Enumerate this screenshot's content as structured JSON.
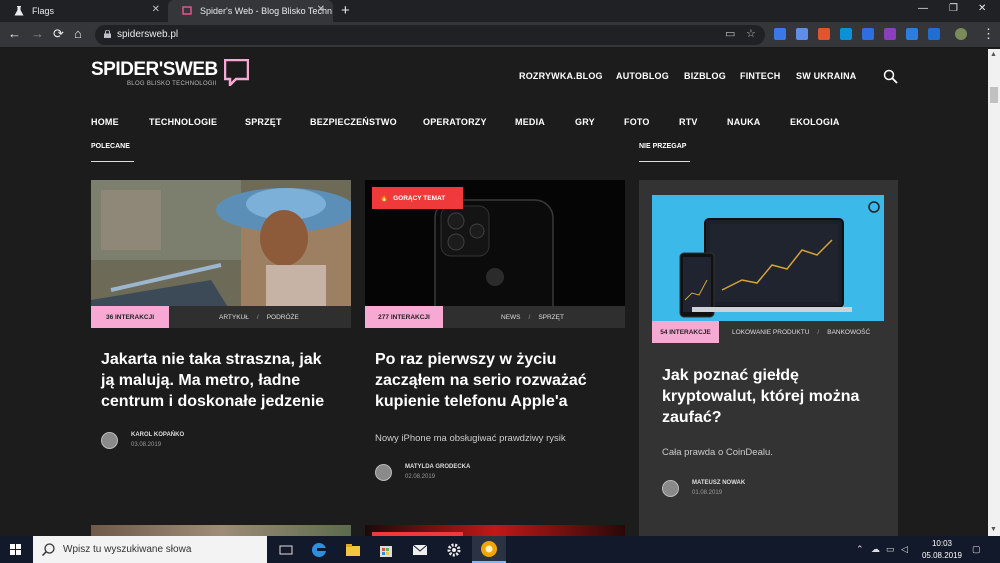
{
  "browser": {
    "tabs": [
      {
        "title": "Flags"
      },
      {
        "title": "Spider's Web - Blog Blisko Techn"
      }
    ],
    "url": "spidersweb.pl"
  },
  "site": {
    "logo": {
      "text": "SPIDER'SWEB",
      "tagline": "BLOG BLISKO TECHNOLOGII"
    },
    "top_nav": [
      "ROZRYWKA.BLOG",
      "AUTOBLOG",
      "BIZBLOG",
      "FINTECH",
      "SW UKRAINA"
    ],
    "main_nav": [
      "HOME",
      "TECHNOLOGIE",
      "SPRZĘT",
      "BEZPIECZEŃSTWO",
      "OPERATORZY",
      "MEDIA",
      "GRY",
      "FOTO",
      "RTV",
      "NAUKA",
      "EKOLOGIA"
    ],
    "sections": {
      "recommended": "POLECANE",
      "dont_miss": "NIE PRZEGAP"
    },
    "articles": [
      {
        "interactions": "36 INTERAKCJI",
        "cats": [
          "ARTYKUŁ",
          "PODRÓŻE"
        ],
        "title_lines": [
          "Jakarta nie taka straszna, jak",
          "ją malują. Ma metro, ładne",
          "centrum i doskonałe jedzenie"
        ],
        "author": "KAROL KOPAŃKO",
        "date": "03.08.2019"
      },
      {
        "hot": "GORĄCY TEMAT",
        "interactions": "277 INTERAKCJI",
        "cats": [
          "NEWS",
          "SPRZĘT"
        ],
        "title_lines": [
          "Po raz pierwszy w życiu",
          "zacząłem na serio rozważać",
          "kupienie telefonu Apple'a"
        ],
        "lead": "Nowy iPhone ma obsługiwać prawdziwy rysik",
        "author": "MATYLDA GRODECKA",
        "date": "02.08.2019"
      },
      {
        "interactions": "54 INTERAKCJE",
        "cats": [
          "LOKOWANIE PRODUKTU",
          "BANKOWOŚĆ"
        ],
        "title_lines": [
          "Jak poznać giełdę",
          "kryptowalut, której można",
          "zaufać?"
        ],
        "lead": "Cała prawda o CoinDealu.",
        "author": "MATEUSZ NOWAK",
        "date": "01.08.2019"
      }
    ]
  },
  "taskbar": {
    "search_placeholder": "Wpisz tu wyszukiwane słowa",
    "time": "10:03",
    "date": "05.08.2019"
  },
  "colors": {
    "accent_pink": "#f7a9d4",
    "hot_red": "#ee3a3a",
    "background": "#1c1c1c"
  }
}
